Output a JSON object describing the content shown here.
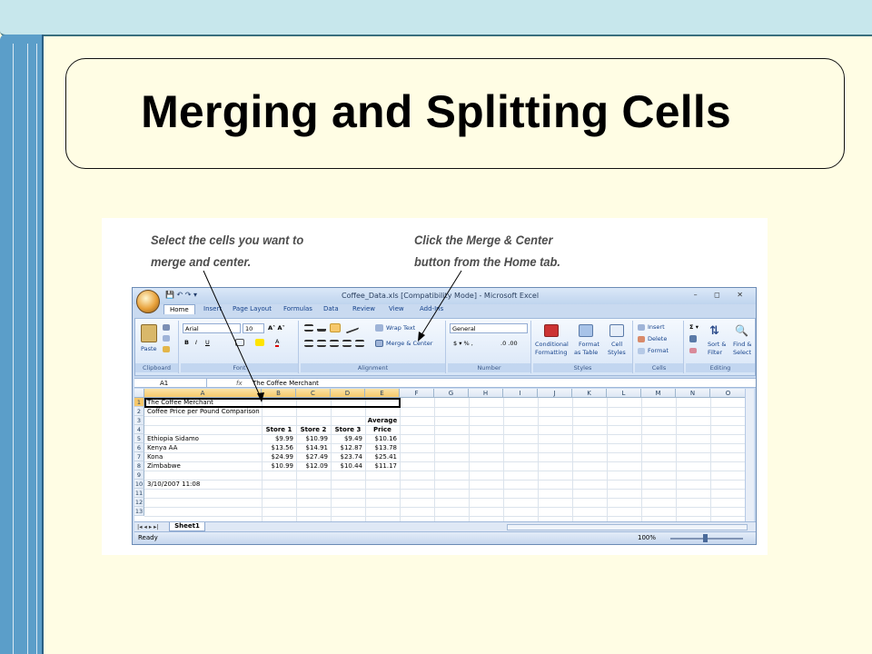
{
  "slide": {
    "title": "Merging and Splitting Cells",
    "callout_left_line1": "Select the cells you want to",
    "callout_left_line2": "merge and center.",
    "callout_right_line1": "Click the Merge & Center",
    "callout_right_line2": "button from the Home tab.",
    "colors": {
      "background": "#fffde4",
      "left_bar": "#5b9ec9",
      "top_band": "#c7e7ec"
    }
  },
  "excel": {
    "window_title": "Coffee_Data.xls  [Compatibility Mode] - Microsoft Excel",
    "window_buttons": "– ◻ ✕",
    "tabs": [
      "Home",
      "Insert",
      "Page Layout",
      "Formulas",
      "Data",
      "Review",
      "View",
      "Add-Ins"
    ],
    "ribbon": {
      "paste": "Paste",
      "font_name": "Arial",
      "font_size": "10",
      "wrap_text": "Wrap Text",
      "merge_center": "Merge & Center",
      "number_format": "General",
      "conditional": "Conditional",
      "formatting": "Formatting",
      "format_as": "Format",
      "as_table": "as Table",
      "cell": "Cell",
      "styles_btn": "Styles",
      "insert": "Insert",
      "delete": "Delete",
      "format": "Format",
      "sort_filter_1": "Sort &",
      "sort_filter_2": "Filter",
      "find_select_1": "Find &",
      "find_select_2": "Select",
      "groups": [
        "Clipboard",
        "Font",
        "Alignment",
        "Number",
        "Styles",
        "Cells",
        "Editing"
      ]
    },
    "name_box": "A1",
    "fx": "fx",
    "formula_value": "The Coffee Merchant",
    "columns": [
      "A",
      "B",
      "C",
      "D",
      "E",
      "F",
      "G",
      "H",
      "I",
      "J",
      "K",
      "L",
      "M",
      "N",
      "O"
    ],
    "rows": [
      "1",
      "2",
      "3",
      "4",
      "5",
      "6",
      "7",
      "8",
      "9",
      "10",
      "11",
      "12",
      "13"
    ],
    "cells": {
      "a1": "The Coffee Merchant",
      "a2": "Coffee Price per Pound Comparison",
      "e3": "Average",
      "b4": "Store 1",
      "c4": "Store 2",
      "d4": "Store 3",
      "e4": "Price",
      "a5": "Ethiopia Sidamo",
      "b5": "$9.99",
      "c5": "$10.99",
      "d5": "$9.49",
      "e5": "$10.16",
      "a6": "Kenya AA",
      "b6": "$13.56",
      "c6": "$14.91",
      "d6": "$12.87",
      "e6": "$13.78",
      "a7": "Kona",
      "b7": "$24.99",
      "c7": "$27.49",
      "d7": "$23.74",
      "e7": "$25.41",
      "a8": "Zimbabwe",
      "b8": "$10.99",
      "c8": "$12.09",
      "d8": "$10.44",
      "e8": "$11.17",
      "a10": "3/10/2007 11:08"
    },
    "sheet_tab": "Sheet1",
    "status_text": "Ready",
    "zoom": "100%"
  }
}
